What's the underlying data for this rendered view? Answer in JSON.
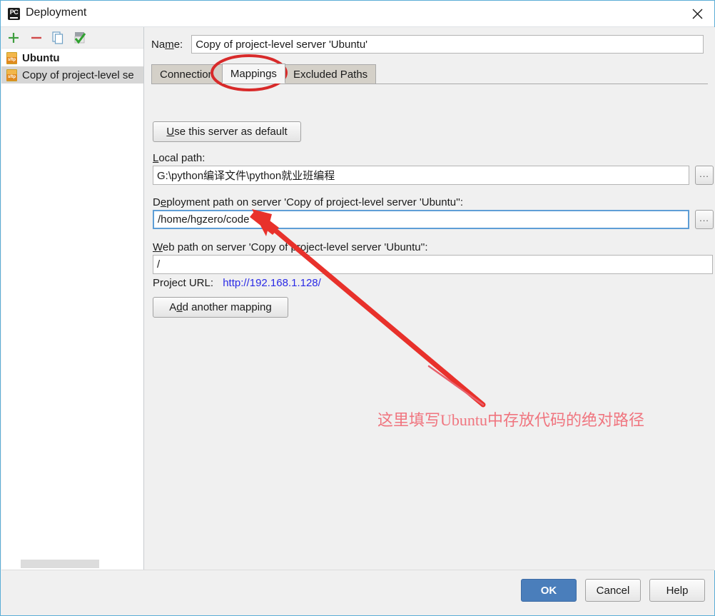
{
  "window": {
    "title": "Deployment",
    "icon": "pycharm-icon",
    "close_icon": "close-icon"
  },
  "sidebar": {
    "toolbar": [
      {
        "name": "add-server-button",
        "icon": "plus-icon"
      },
      {
        "name": "remove-server-button",
        "icon": "minus-icon"
      },
      {
        "name": "copy-server-button",
        "icon": "copy-icon"
      },
      {
        "name": "set-default-button",
        "icon": "green-check-icon"
      }
    ],
    "servers": [
      {
        "label": "Ubuntu",
        "bold": true,
        "selected": false
      },
      {
        "label": "Copy of project-level se",
        "bold": false,
        "selected": true
      }
    ]
  },
  "form": {
    "name_label": "Name:",
    "name_label_pre": "Na",
    "name_label_underline": "m",
    "name_label_post": "e:",
    "name_value": "Copy of project-level server 'Ubuntu'",
    "tabs": [
      {
        "label": "Connection",
        "active": false
      },
      {
        "label": "Mappings",
        "active": true
      },
      {
        "label": "Excluded Paths",
        "active": false
      }
    ],
    "use_default_pre": "",
    "use_default_underline": "U",
    "use_default_post": "se this server as default",
    "local_path_label_pre": "",
    "local_path_label_underline": "L",
    "local_path_label_post": "ocal path:",
    "local_path_value": "G:\\python编译文件\\python就业班编程",
    "deploy_path_label_pre": "D",
    "deploy_path_label_underline": "e",
    "deploy_path_label_post": "ployment path on server 'Copy of project-level server 'Ubuntu'':",
    "deploy_path_value": "/home/hgzero/code",
    "web_path_label_pre": "",
    "web_path_label_underline": "W",
    "web_path_label_post": "eb path on server 'Copy of project-level server 'Ubuntu'':",
    "web_path_value": "/",
    "project_url_label": "Project URL:",
    "project_url_value": "http://192.168.1.128/",
    "add_mapping_pre": "A",
    "add_mapping_underline": "d",
    "add_mapping_post": "d another mapping",
    "browse_label": "..."
  },
  "annotation": {
    "note_text": "这里填写Ubuntu中存放代码的绝对路径",
    "note_color": "#f0757f",
    "ellipse_color": "#d82a2a",
    "arrow_color": "#e8312b"
  },
  "footer": {
    "ok_label": "OK",
    "cancel_label": "Cancel",
    "help_label": "Help",
    "ok_color": "#4a7ebb"
  }
}
